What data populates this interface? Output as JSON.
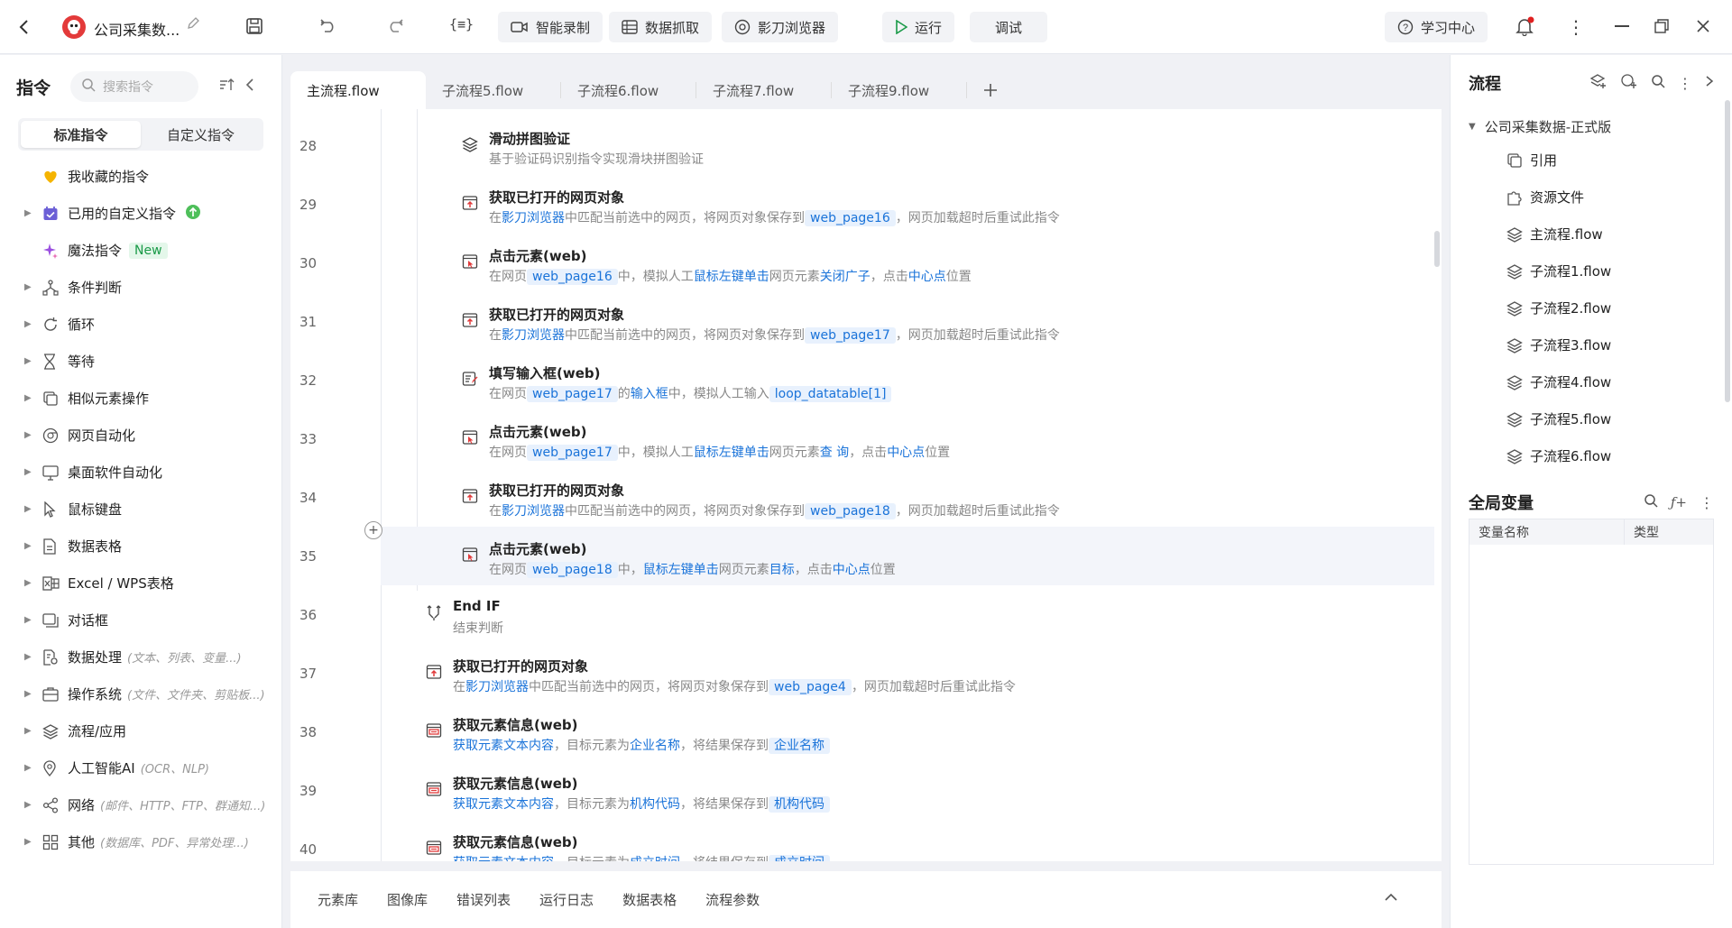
{
  "titlebar": {
    "app_title": "公司采集数...",
    "smart_record": "智能录制",
    "data_capture": "数据抓取",
    "browser": "影刀浏览器",
    "run": "运行",
    "debug": "调试",
    "learn": "学习中心"
  },
  "left": {
    "title": "指令",
    "search_placeholder": "搜索指令",
    "tab_standard": "标准指令",
    "tab_custom": "自定义指令",
    "categories": [
      {
        "label": "我收藏的指令",
        "hint": "",
        "icon": "heart-icon",
        "color": "#f5b400",
        "arrow": false
      },
      {
        "label": "已用的自定义指令",
        "hint": "",
        "icon": "calendar-icon",
        "arrow": true
      },
      {
        "label": "魔法指令",
        "hint": "",
        "badge": "New",
        "icon": "sparkle-icon",
        "color": "#9b4fe0",
        "arrow": false
      },
      {
        "label": "条件判断",
        "hint": "",
        "icon": "branch-icon",
        "arrow": true
      },
      {
        "label": "循环",
        "hint": "",
        "icon": "loop-icon",
        "arrow": true
      },
      {
        "label": "等待",
        "hint": "",
        "icon": "hourglass-icon",
        "arrow": true
      },
      {
        "label": "相似元素操作",
        "hint": "",
        "icon": "copy-icon",
        "arrow": true
      },
      {
        "label": "网页自动化",
        "hint": "",
        "icon": "browser-icon",
        "arrow": true
      },
      {
        "label": "桌面软件自动化",
        "hint": "",
        "icon": "monitor-icon",
        "arrow": true
      },
      {
        "label": "鼠标键盘",
        "hint": "",
        "icon": "cursor-icon",
        "arrow": true
      },
      {
        "label": "数据表格",
        "hint": "",
        "icon": "doc-icon",
        "arrow": true
      },
      {
        "label": "Excel / WPS表格",
        "hint": "",
        "icon": "excel-icon",
        "arrow": true
      },
      {
        "label": "对话框",
        "hint": "",
        "icon": "dialog-icon",
        "arrow": true
      },
      {
        "label": "数据处理",
        "hint": "(文本、列表、变量...)",
        "icon": "data-icon",
        "arrow": true
      },
      {
        "label": "操作系统",
        "hint": "(文件、文件夹、剪贴板...)",
        "icon": "briefcase-icon",
        "arrow": true
      },
      {
        "label": "流程/应用",
        "hint": "",
        "icon": "layers-icon",
        "arrow": true
      },
      {
        "label": "人工智能AI",
        "hint": "(OCR、NLP)",
        "icon": "location-icon",
        "arrow": true
      },
      {
        "label": "网络",
        "hint": "(邮件、HTTP、FTP、群通知...)",
        "icon": "share-icon",
        "arrow": true
      },
      {
        "label": "其他",
        "hint": "(数据库、PDF、异常处理...)",
        "icon": "grid-icon",
        "arrow": true
      }
    ]
  },
  "tabs": [
    "主流程.flow",
    "子流程5.flow",
    "子流程6.flow",
    "子流程7.flow",
    "子流程9.flow"
  ],
  "lines": [
    {
      "num": "28",
      "indent": 2,
      "icon": "layers",
      "title": "滑动拼图验证",
      "desc": [
        {
          "t": "基于验证码识别指令实现滑块拼图验证",
          "k": "n"
        }
      ]
    },
    {
      "num": "29",
      "indent": 2,
      "icon": "page",
      "title": "获取已打开的网页对象",
      "desc": [
        {
          "t": "在",
          "k": "n"
        },
        {
          "t": "影刀浏览器",
          "k": "l"
        },
        {
          "t": "中匹配当前选中的网页，将网页对象保存到",
          "k": "n"
        },
        {
          "t": "web_page16",
          "k": "v"
        },
        {
          "t": "，网页加载超时后重试此指令",
          "k": "n"
        }
      ]
    },
    {
      "num": "30",
      "indent": 2,
      "icon": "click",
      "title": "点击元素(web)",
      "desc": [
        {
          "t": "在网页",
          "k": "n"
        },
        {
          "t": "web_page16",
          "k": "v"
        },
        {
          "t": "中，模拟人工",
          "k": "n"
        },
        {
          "t": "鼠标左键单击",
          "k": "l"
        },
        {
          "t": "网页元素",
          "k": "n"
        },
        {
          "t": "关闭广子",
          "k": "l"
        },
        {
          "t": "，点击",
          "k": "n"
        },
        {
          "t": "中心点",
          "k": "l"
        },
        {
          "t": "位置",
          "k": "n"
        }
      ]
    },
    {
      "num": "31",
      "indent": 2,
      "icon": "page",
      "title": "获取已打开的网页对象",
      "desc": [
        {
          "t": "在",
          "k": "n"
        },
        {
          "t": "影刀浏览器",
          "k": "l"
        },
        {
          "t": "中匹配当前选中的网页，将网页对象保存到",
          "k": "n"
        },
        {
          "t": "web_page17",
          "k": "v"
        },
        {
          "t": "，网页加载超时后重试此指令",
          "k": "n"
        }
      ]
    },
    {
      "num": "32",
      "indent": 2,
      "icon": "input",
      "title": "填写输入框(web)",
      "desc": [
        {
          "t": "在网页",
          "k": "n"
        },
        {
          "t": "web_page17",
          "k": "v"
        },
        {
          "t": "的",
          "k": "n"
        },
        {
          "t": "输入框",
          "k": "l"
        },
        {
          "t": "中，模拟人工输入",
          "k": "n"
        },
        {
          "t": "loop_datatable[1]",
          "k": "v"
        }
      ]
    },
    {
      "num": "33",
      "indent": 2,
      "icon": "click",
      "title": "点击元素(web)",
      "desc": [
        {
          "t": "在网页",
          "k": "n"
        },
        {
          "t": "web_page17",
          "k": "v"
        },
        {
          "t": "中，模拟人工",
          "k": "n"
        },
        {
          "t": "鼠标左键单击",
          "k": "l"
        },
        {
          "t": "网页元素",
          "k": "n"
        },
        {
          "t": "查 询",
          "k": "l"
        },
        {
          "t": "，点击",
          "k": "n"
        },
        {
          "t": "中心点",
          "k": "l"
        },
        {
          "t": "位置",
          "k": "n"
        }
      ]
    },
    {
      "num": "34",
      "indent": 2,
      "icon": "page",
      "title": "获取已打开的网页对象",
      "desc": [
        {
          "t": "在",
          "k": "n"
        },
        {
          "t": "影刀浏览器",
          "k": "l"
        },
        {
          "t": "中匹配当前选中的网页，将网页对象保存到",
          "k": "n"
        },
        {
          "t": "web_page18",
          "k": "v"
        },
        {
          "t": "，网页加载超时后重试此指令",
          "k": "n"
        }
      ]
    },
    {
      "num": "35",
      "indent": 2,
      "icon": "click",
      "title": "点击元素(web)",
      "desc": [
        {
          "t": "在网页",
          "k": "n"
        },
        {
          "t": "web_page18",
          "k": "v"
        },
        {
          "t": "中，",
          "k": "n"
        },
        {
          "t": "鼠标左键单击",
          "k": "l"
        },
        {
          "t": "网页元素",
          "k": "n"
        },
        {
          "t": "目标",
          "k": "l"
        },
        {
          "t": "，点击",
          "k": "n"
        },
        {
          "t": "中心点",
          "k": "l"
        },
        {
          "t": "位置",
          "k": "n"
        }
      ],
      "highlight": true
    },
    {
      "num": "36",
      "indent": 1,
      "icon": "endif",
      "title": "End IF",
      "desc": [
        {
          "t": "结束判断",
          "k": "n"
        }
      ]
    },
    {
      "num": "37",
      "indent": 1,
      "icon": "page",
      "title": "获取已打开的网页对象",
      "desc": [
        {
          "t": "在",
          "k": "n"
        },
        {
          "t": "影刀浏览器",
          "k": "l"
        },
        {
          "t": "中匹配当前选中的网页，将网页对象保存到",
          "k": "n"
        },
        {
          "t": "web_page4",
          "k": "v"
        },
        {
          "t": "，网页加载超时后重试此指令",
          "k": "n"
        }
      ]
    },
    {
      "num": "38",
      "indent": 1,
      "icon": "info",
      "title": "获取元素信息(web)",
      "desc": [
        {
          "t": "获取元素文本内容",
          "k": "l"
        },
        {
          "t": "，目标元素为",
          "k": "n"
        },
        {
          "t": "企业名称",
          "k": "l"
        },
        {
          "t": "，将结果保存到",
          "k": "n"
        },
        {
          "t": "企业名称",
          "k": "v"
        }
      ]
    },
    {
      "num": "39",
      "indent": 1,
      "icon": "info",
      "title": "获取元素信息(web)",
      "desc": [
        {
          "t": "获取元素文本内容",
          "k": "l"
        },
        {
          "t": "，目标元素为",
          "k": "n"
        },
        {
          "t": "机构代码",
          "k": "l"
        },
        {
          "t": "，将结果保存到",
          "k": "n"
        },
        {
          "t": "机构代码",
          "k": "v"
        }
      ]
    },
    {
      "num": "40",
      "indent": 1,
      "icon": "info",
      "title": "获取元素信息(web)",
      "desc": [
        {
          "t": "获取元素文本内容",
          "k": "l"
        },
        {
          "t": "，目标元素为",
          "k": "n"
        },
        {
          "t": "成立时间",
          "k": "l"
        },
        {
          "t": "，将结果保存到",
          "k": "n"
        },
        {
          "t": "成立时间",
          "k": "v"
        }
      ]
    }
  ],
  "bottom_tabs": [
    "元素库",
    "图像库",
    "错误列表",
    "运行日志",
    "数据表格",
    "流程参数"
  ],
  "right": {
    "flow_title": "流程",
    "project": "公司采集数据-正式版",
    "items": [
      {
        "label": "引用",
        "icon": "copy-icon"
      },
      {
        "label": "资源文件",
        "icon": "puzzle-icon"
      },
      {
        "label": "主流程.flow",
        "icon": "layers-icon"
      },
      {
        "label": "子流程1.flow",
        "icon": "layers-icon"
      },
      {
        "label": "子流程2.flow",
        "icon": "layers-icon"
      },
      {
        "label": "子流程3.flow",
        "icon": "layers-icon"
      },
      {
        "label": "子流程4.flow",
        "icon": "layers-icon"
      },
      {
        "label": "子流程5.flow",
        "icon": "layers-icon"
      },
      {
        "label": "子流程6.flow",
        "icon": "layers-icon"
      }
    ],
    "vars_title": "全局变量",
    "col_name": "变量名称",
    "col_type": "类型"
  },
  "colors": {
    "accent": "#1a73d9",
    "var_bg": "#e8f1fd",
    "notify_dot": "#e02020",
    "badge_green": "#1a9a48"
  }
}
